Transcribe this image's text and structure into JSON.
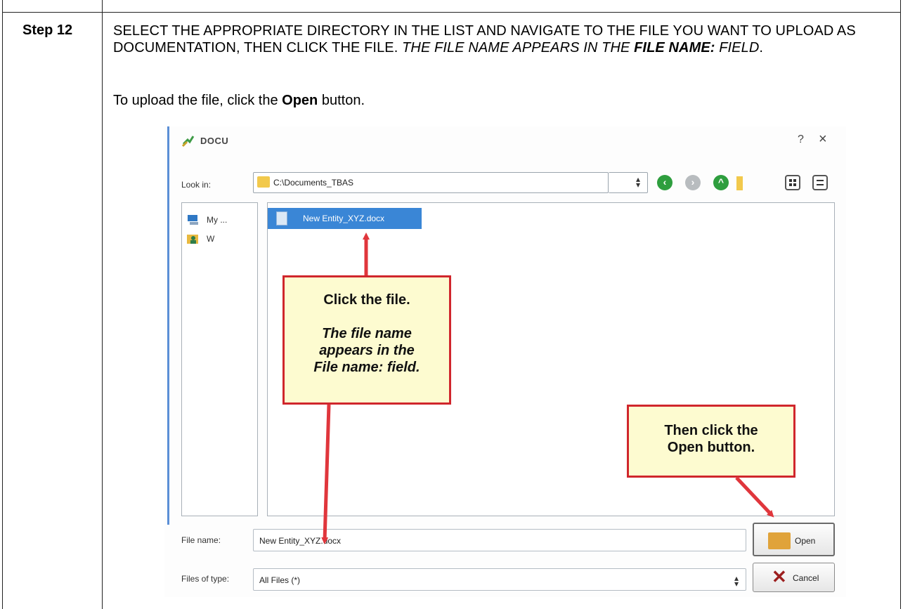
{
  "step": {
    "label": "Step 12",
    "instruction_caps": "SELECT THE APPROPRIATE DIRECTORY IN THE LIST AND NAVIGATE TO THE FILE YOU WANT TO UPLOAD AS DOCUMENTATION, THEN CLICK THE FILE.",
    "instruction_italic_pre": "THE FILE NAME APPEARS IN THE",
    "instruction_italic_bold": "FILE NAME:",
    "instruction_italic_post": "FIELD",
    "instruction_end": ".",
    "upload_pre": "To upload the file, click the",
    "upload_bold": "Open",
    "upload_post": "button."
  },
  "dialog": {
    "title": "DOCU",
    "help": "?",
    "close": "×",
    "look_in_label": "Look in:",
    "look_in_value": "C:\\Documents_TBAS",
    "sidebar": [
      {
        "label": "My ...",
        "icon": "computer-icon"
      },
      {
        "label": "W",
        "icon": "user-folder-icon"
      }
    ],
    "selected_file": "New Entity_XYZ.docx",
    "file_name_label": "File name:",
    "file_name_value": "New Entity_XYZ.docx",
    "files_of_type_label": "Files of type:",
    "files_of_type_value": "All Files (*)",
    "open_label": "Open",
    "cancel_label": "Cancel"
  },
  "callouts": {
    "click_file_line1": "Click the file.",
    "click_file_line2": "The file name",
    "click_file_line3": "appears in the",
    "click_file_line4": "File name: field.",
    "open_line1": "Then click the",
    "open_line2": "Open button."
  },
  "colors": {
    "callout_border": "#d0262c",
    "callout_fill": "#fdfbd0",
    "selection": "#3a86d6",
    "nav_green": "#2e9e3e"
  }
}
